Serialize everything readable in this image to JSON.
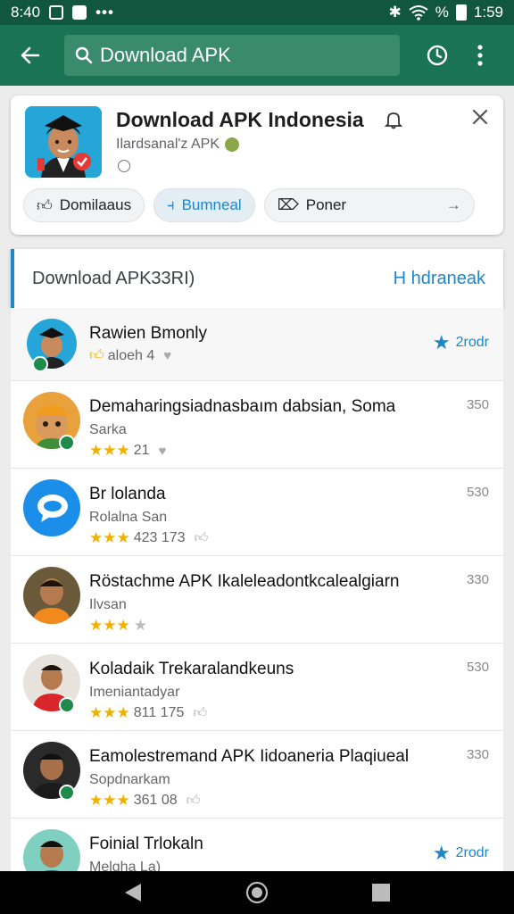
{
  "status_bar": {
    "time_left": "8:40",
    "battery_text": "%",
    "time_right": "1:59"
  },
  "search": {
    "query": "Download APK"
  },
  "app": {
    "title": "Download APK Indonesia",
    "developer": "Ilardsanal'z APK",
    "chips": [
      {
        "label": "Domilaaus"
      },
      {
        "label": "Bumneal"
      },
      {
        "label": "Poner"
      }
    ]
  },
  "filter": {
    "label": "Download APK33RI)",
    "action": "H hdraneak"
  },
  "list": [
    {
      "title": "Rawien Bmonly",
      "meta": "aloeh 4",
      "rating": "2rodr",
      "stars": 0,
      "thumb": true
    },
    {
      "title": "Demaharingsiadnasbaım dabsian, Soma",
      "sub": "Sarka",
      "meta": "21",
      "count": "350",
      "stars": 3
    },
    {
      "title": "Br lolanda",
      "sub": "Rolalna San",
      "meta": "423  173",
      "count": "530",
      "stars": 3
    },
    {
      "title": "Röstachme APK Ikaleleadontkcalealgiarn",
      "sub": "Ilvsan",
      "meta": "",
      "count": "330",
      "stars": 3,
      "empty_star": true
    },
    {
      "title": "Koladaik Trekaralandkeuns",
      "sub": "Imeniantadyar",
      "meta": "811  175",
      "count": "530",
      "stars": 3
    },
    {
      "title": "Eamolestremand APK Iidoaneria Plaqiueal",
      "sub": "Sopdnarkam",
      "meta": "361  08",
      "count": "330",
      "stars": 3
    },
    {
      "title": "Foinial Trlokaln",
      "sub": "Melgha La)",
      "rating": "2rodr",
      "stars": 0
    }
  ],
  "colors": {
    "primary": "#1a7355",
    "status": "#11563f",
    "accent": "#1f86c8",
    "star": "#f0b000"
  }
}
